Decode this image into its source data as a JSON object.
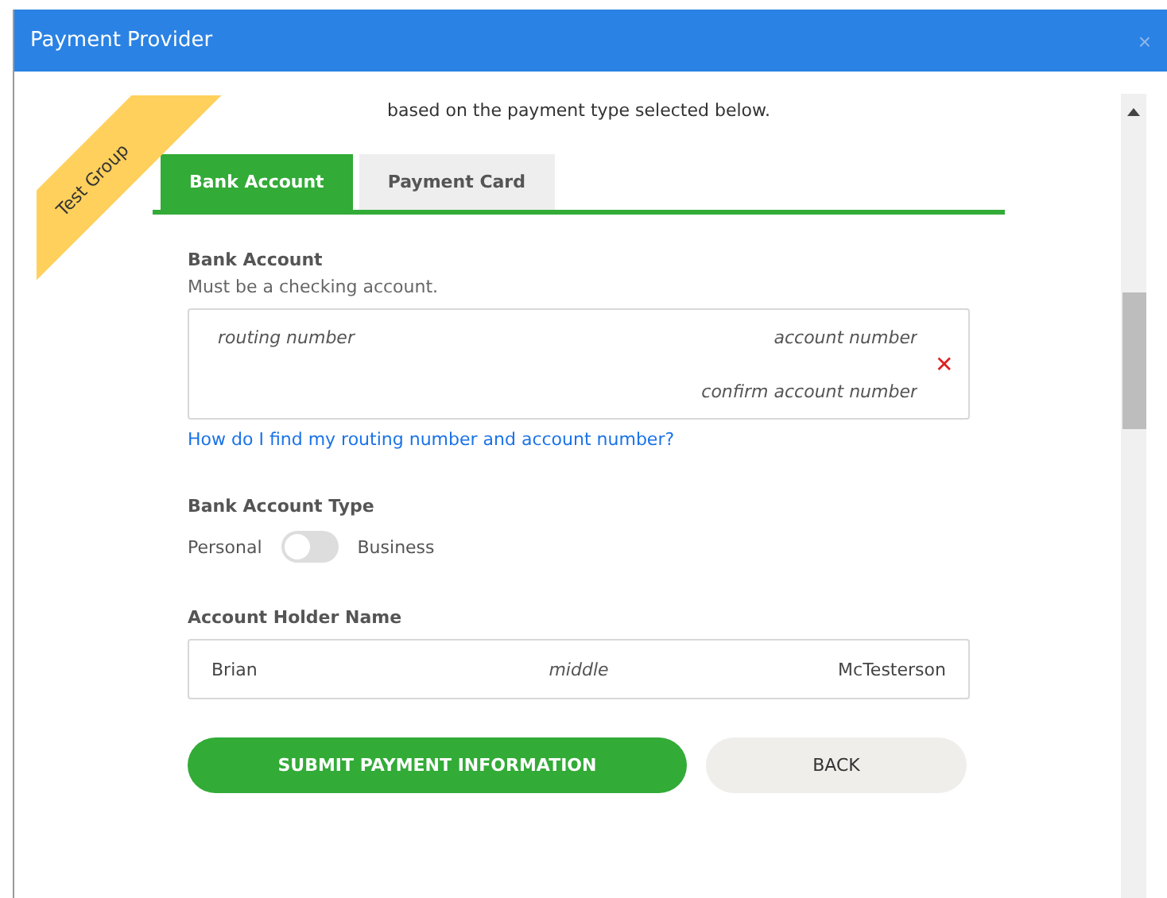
{
  "window": {
    "title": "Payment Provider",
    "close": "×"
  },
  "ribbon": "Test Group",
  "intro": "based on the payment type selected below.",
  "tabs": [
    {
      "label": "Bank Account",
      "selected": true
    },
    {
      "label": "Payment Card",
      "selected": false
    }
  ],
  "bank": {
    "heading": "Bank Account",
    "hint": "Must be a checking account.",
    "routing": {
      "placeholder": "routing number"
    },
    "account": {
      "placeholder": "account number"
    },
    "confirm": {
      "placeholder": "confirm account number"
    },
    "clear": "✕",
    "help_link": "How do I find my routing number and account number?"
  },
  "account_type": {
    "heading": "Bank Account Type",
    "left": "Personal",
    "right": "Business",
    "on": false
  },
  "holder": {
    "heading": "Account Holder Name",
    "first": {
      "value": "Brian"
    },
    "middle": {
      "placeholder": "middle"
    },
    "last": {
      "value": "McTesterson"
    }
  },
  "buttons": [
    {
      "label": "SUBMIT PAYMENT INFORMATION",
      "kind": "primary"
    },
    {
      "label": "BACK",
      "kind": "secondary"
    }
  ]
}
